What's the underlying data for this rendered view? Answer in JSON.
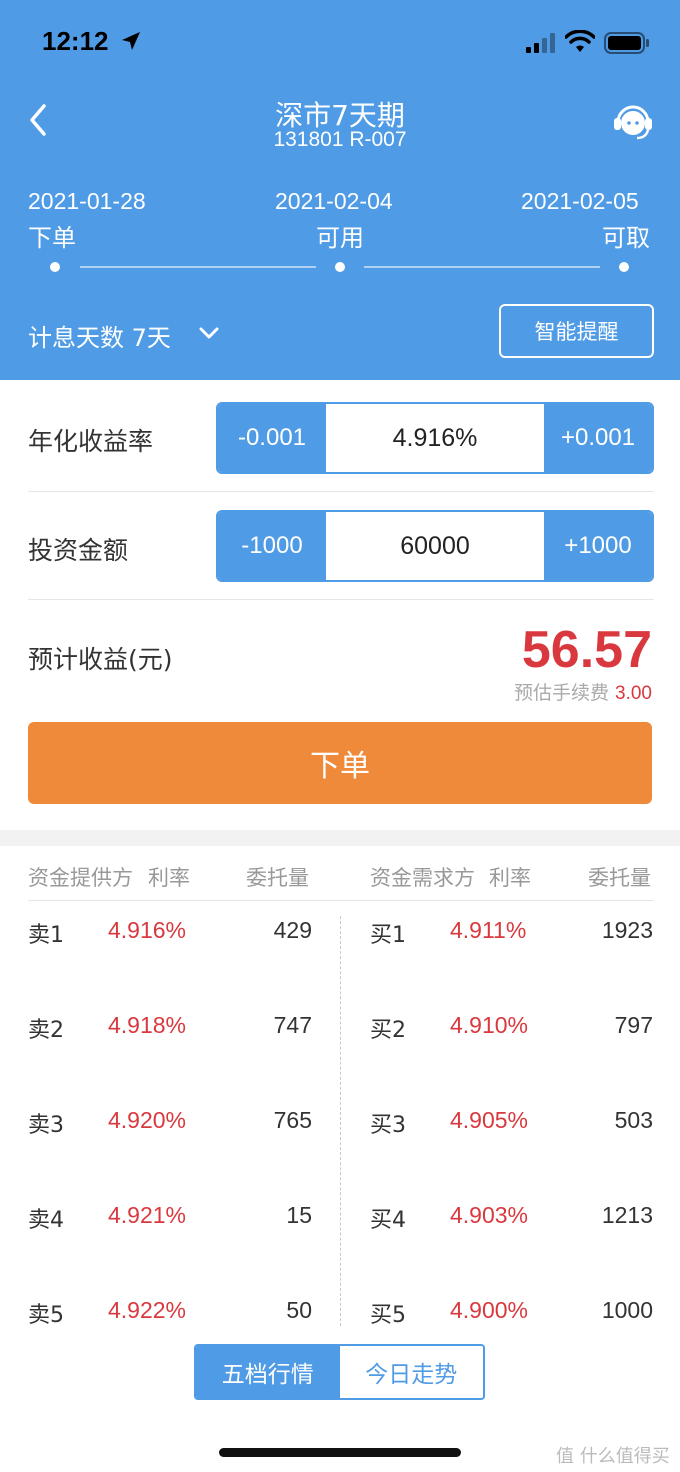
{
  "status_bar": {
    "time": "12:12"
  },
  "header": {
    "title": "深市7天期",
    "subtitle": "131801 R-007",
    "timeline": [
      {
        "date": "2021-01-28",
        "label": "下单"
      },
      {
        "date": "2021-02-04",
        "label": "可用"
      },
      {
        "date": "2021-02-05",
        "label": "可取"
      }
    ],
    "interest_days": "计息天数 7天",
    "remind_button": "智能提醒"
  },
  "form": {
    "rate": {
      "label": "年化收益率",
      "minus": "-0.001",
      "value": "4.916%",
      "plus": "+0.001"
    },
    "amount": {
      "label": "投资金额",
      "minus": "-1000",
      "value": "60000",
      "plus": "+1000"
    },
    "profit_label": "预计收益(元)",
    "profit_value": "56.57",
    "fee_label": "预估手续费",
    "fee_value": "3.00",
    "order_button": "下单"
  },
  "order_book": {
    "left_headers": {
      "side": "资金提供方",
      "rate": "利率",
      "qty": "委托量"
    },
    "right_headers": {
      "side": "资金需求方",
      "rate": "利率",
      "qty": "委托量"
    },
    "sell": [
      {
        "label": "卖1",
        "rate": "4.916%",
        "qty": "429"
      },
      {
        "label": "卖2",
        "rate": "4.918%",
        "qty": "747"
      },
      {
        "label": "卖3",
        "rate": "4.920%",
        "qty": "765"
      },
      {
        "label": "卖4",
        "rate": "4.921%",
        "qty": "15"
      },
      {
        "label": "卖5",
        "rate": "4.922%",
        "qty": "50"
      }
    ],
    "buy": [
      {
        "label": "买1",
        "rate": "4.911%",
        "qty": "1923"
      },
      {
        "label": "买2",
        "rate": "4.910%",
        "qty": "797"
      },
      {
        "label": "买3",
        "rate": "4.905%",
        "qty": "503"
      },
      {
        "label": "买4",
        "rate": "4.903%",
        "qty": "1213"
      },
      {
        "label": "买5",
        "rate": "4.900%",
        "qty": "1000"
      }
    ]
  },
  "tabs": {
    "five_levels": "五档行情",
    "today_trend": "今日走势"
  },
  "watermark": "值 什么值得买",
  "colors": {
    "primary": "#4f9be5",
    "accent": "#ef8a3a",
    "red": "#d9393e"
  }
}
